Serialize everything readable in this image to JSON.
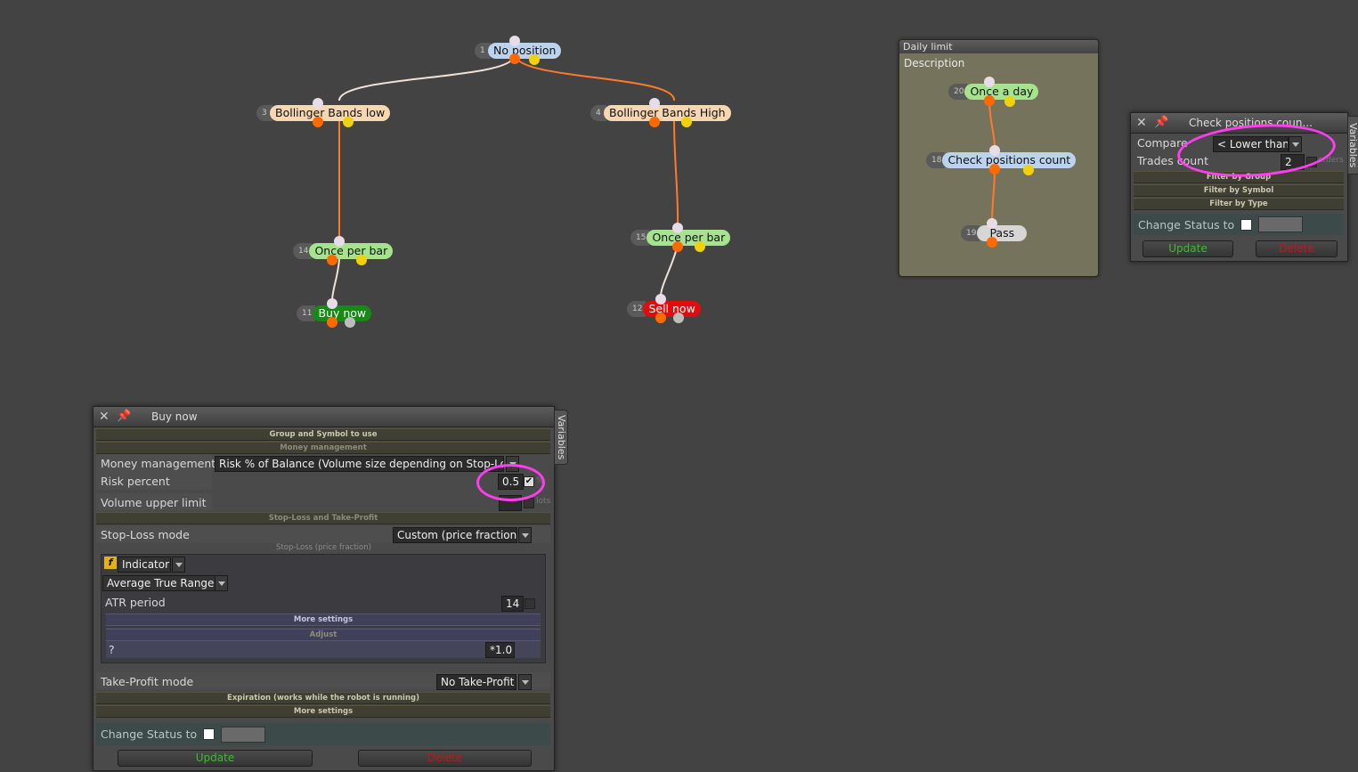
{
  "graph": {
    "nodes": [
      {
        "id": "n1",
        "num": "1",
        "label": "No position",
        "color": "blue"
      },
      {
        "id": "n3",
        "num": "3",
        "label": "Bollinger Bands low",
        "color": "tan"
      },
      {
        "id": "n4",
        "num": "4",
        "label": "Bollinger Bands High",
        "color": "tan"
      },
      {
        "id": "n14",
        "num": "14",
        "label": "Once per bar",
        "color": "green"
      },
      {
        "id": "n15",
        "num": "15",
        "label": "Once per bar",
        "color": "green"
      },
      {
        "id": "n11",
        "num": "11",
        "label": "Buy now",
        "color": "buy"
      },
      {
        "id": "n12",
        "num": "12",
        "label": "Sell now",
        "color": "sell"
      }
    ]
  },
  "group_box": {
    "title": "Daily limit",
    "description": "Description",
    "nodes": [
      {
        "id": "n20",
        "num": "20",
        "label": "Once a day",
        "color": "green"
      },
      {
        "id": "n18",
        "num": "18",
        "label": "Check positions count",
        "color": "blue"
      },
      {
        "id": "n19",
        "num": "19",
        "label": "Pass",
        "color": "grey"
      }
    ]
  },
  "check_panel": {
    "title": "Check positions coun...",
    "compare_label": "Compare",
    "compare_value": "< Lower than",
    "trades_label": "Trades count",
    "trades_value": "2",
    "orders_label": "orders",
    "sections": [
      "Filter by Group",
      "Filter by Symbol",
      "Filter by Type"
    ],
    "change_status_label": "Change Status to",
    "update_label": "Update",
    "delete_label": "Delete",
    "variables_tab": "Variables"
  },
  "buy_panel": {
    "title": "Buy now",
    "sec_group": "Group and Symbol to use",
    "sec_money": "Money management",
    "money_label": "Money management",
    "money_value": "Risk % of Balance (Volume size depending on Stop-Loss)",
    "risk_label": "Risk percent",
    "risk_value": "0.5",
    "risk_unit": "%",
    "volume_label": "Volume upper limit",
    "volume_unit": "lots",
    "sec_sltp": "Stop-Loss and Take-Profit",
    "sl_mode_label": "Stop-Loss mode",
    "sl_mode_value": "Custom (price fraction)",
    "sl_sub": "Stop-Loss (price fraction)",
    "indicator_label": "Indicator",
    "indicator_value": "Average True Range",
    "atr_label": "ATR period",
    "atr_value": "14",
    "more_settings": "More settings",
    "adjust_label": "Adjust",
    "adjust_prefix": "?",
    "adjust_value": "*1.0",
    "tp_mode_label": "Take-Profit mode",
    "tp_mode_value": "No Take-Profit",
    "sec_expiration": "Expiration (works while the robot is running)",
    "sec_more": "More settings",
    "change_status_label": "Change Status to",
    "update_label": "Update",
    "delete_label": "Delete",
    "variables_tab": "Variables"
  },
  "colors": {
    "accent": "#ff3df0",
    "update": "#3dbb2e",
    "delete": "#c01818"
  }
}
